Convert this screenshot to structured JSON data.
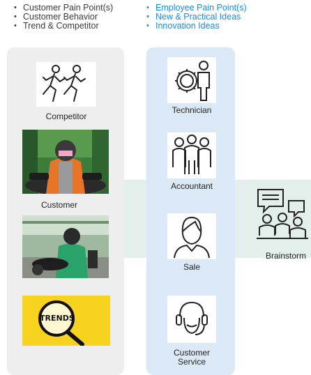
{
  "left_bullets": [
    "Customer Pain Point(s)",
    "Customer Behavior",
    "Trend & Competitor"
  ],
  "right_bullets": [
    "Employee Pain Point(s)",
    "New & Practical Ideas",
    "Innovation Ideas"
  ],
  "left_column": {
    "competitor_label": "Competitor",
    "customer_label": "Customer",
    "trends_text": "TRENDS"
  },
  "middle_column": {
    "technician_label": "Technician",
    "accountant_label": "Accountant",
    "sale_label": "Sale",
    "customer_service_line1": "Customer",
    "customer_service_line2": "Service"
  },
  "brainstorm_label": "Brainstorm",
  "colors": {
    "left_bullet_text": "#3a3a3a",
    "right_bullet_text": "#1f8bd6",
    "left_column_bg": "#eeeeee",
    "middle_column_bg": "#dbe8f6",
    "band_bg": "#e2efeb",
    "trends_bg": "#f7d21f"
  }
}
